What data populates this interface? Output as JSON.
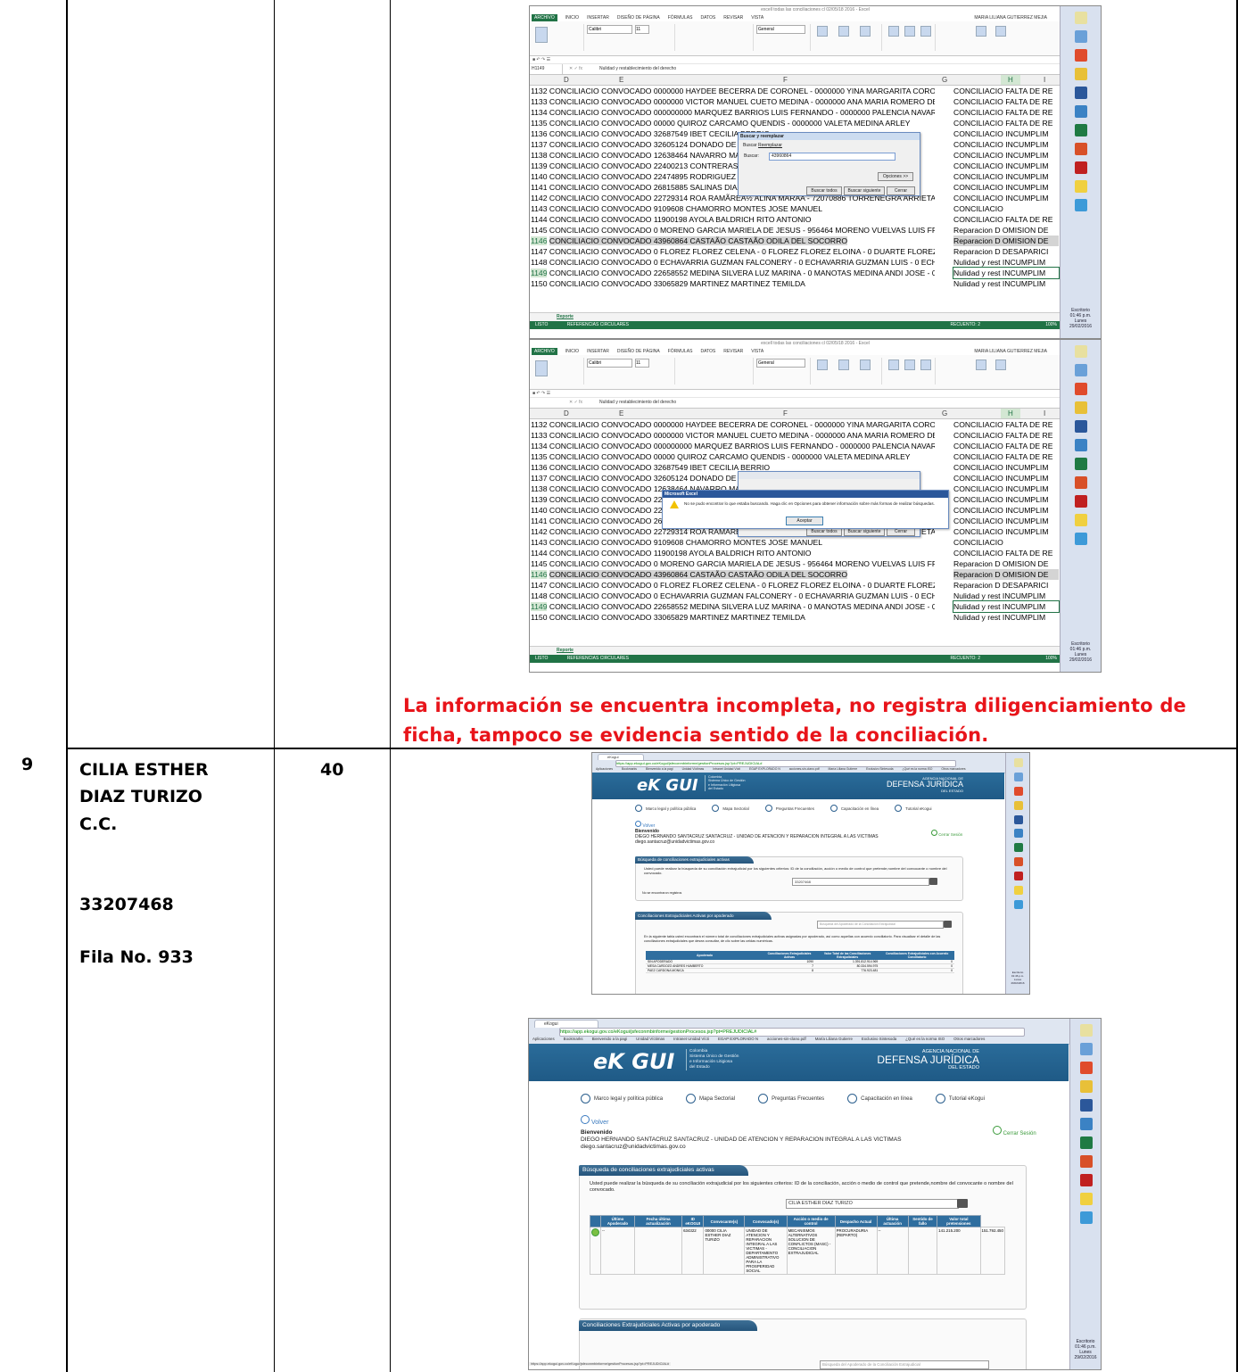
{
  "row9": {
    "number": "9",
    "name_line1": "CILIA ESTHER",
    "name_line2": "DIAZ TURIZO",
    "id_type": "C.C.",
    "id_number": "33207468",
    "row_ref": "Fila No. 933",
    "count": "40"
  },
  "note": "La información se encuentra incompleta, no registra diligenciamiento de ficha, tampoco se evidencia sentido de la conciliación.",
  "excel": {
    "title": "excell todas las conciliaciones cl 02/05/18 2016 - Excel",
    "tabs": [
      "ARCHIVO",
      "INICIO",
      "INSERTAR",
      "DISEÑO DE PÁGINA",
      "FÓRMULAS",
      "DATOS",
      "REVISAR",
      "VISTA"
    ],
    "user": "MARIA LILIANA GUTIERREZ MEJIA",
    "font_name": "Calibri",
    "font_size": "11",
    "number_format": "General",
    "cell_ref": "H1149",
    "formula": "Nulidad y restablecimiento del derecho",
    "columns": [
      "D",
      "E",
      "F",
      "G",
      "H",
      "I"
    ],
    "rows": [
      {
        "n": "1132",
        "text": "CONCILIACIO CONVOCADO 0000000  HAYDEE BECERRA DE CORONEL - 0000000  YINA MARGARITA CORONEL BECE",
        "h": "CONCILIACIO FALTA DE RE"
      },
      {
        "n": "1133",
        "text": "CONCILIACIO CONVOCADO 0000000  VICTOR MANUEL CUETO MEDINA - 0000000  ANA MARIA ROMERO DE CUET",
        "h": "CONCILIACIO FALTA DE RE"
      },
      {
        "n": "1134",
        "text": "CONCILIACIO CONVOCADO 000000000 MARQUEZ  BARRIOS LUIS FERNANDO  - 0000000 PALENCIA  NAVARRO  ONI",
        "h": "CONCILIACIO FALTA DE RE"
      },
      {
        "n": "1135",
        "text": "CONCILIACIO CONVOCADO 00000 QUIROZ  CARCAMO QUENDIS  - 0000000 VALETA  MEDINA  ARLEY",
        "h": "CONCILIACIO FALTA DE RE"
      },
      {
        "n": "1136",
        "text": "CONCILIACIO CONVOCADO 32687549 IBET CECILIA  BERRIO",
        "h": "CONCILIACIO INCUMPLIM"
      },
      {
        "n": "1137",
        "text": "CONCILIACIO CONVOCADO 32605124 DONADO  DE DONADO",
        "h": "CONCILIACIO INCUMPLIM"
      },
      {
        "n": "1138",
        "text": "CONCILIACIO CONVOCADO 12638464 NAVARRO MANOTAS",
        "h": "CONCILIACIO INCUMPLIM"
      },
      {
        "n": "1139",
        "text": "CONCILIACIO CONVOCADO 22400213 CONTRERAS ROMERO",
        "h": "CONCILIACIO INCUMPLIM"
      },
      {
        "n": "1140",
        "text": "CONCILIACIO CONVOCADO 22474895 RODRIGUEZ BALLESTAS",
        "h": "CONCILIACIO INCUMPLIM"
      },
      {
        "n": "1141",
        "text": "CONCILIACIO CONVOCADO 26815885 SALINAS DIAZ  JULIA",
        "h": "CONCILIACIO INCUMPLIM"
      },
      {
        "n": "1142",
        "text": "CONCILIACIO CONVOCADO 22729314 ROA  RAMÃREÃ½ ALINA MARÃA - 72070886  TORRENEGRA  ARRIETA FIDEL E",
        "h": "CONCILIACIO INCUMPLIM"
      },
      {
        "n": "1143",
        "text": "CONCILIACIO CONVOCADO 9109608 CHAMORRO  MONTES JOSE MANUEL",
        "h": "CONCILIACIO"
      },
      {
        "n": "1144",
        "text": "CONCILIACIO CONVOCADO 11900198 AYOLA  BALDRICH RITO ANTONIO",
        "h": "CONCILIACIO FALTA DE RE"
      },
      {
        "n": "1145",
        "text": "CONCILIACIO CONVOCADO 0 MORENO GARCIA MARIELA DE JESUS - 956464 MORENO VUELVAS LUIS FRANCISCO -",
        "h": "Reparacion D OMISION DE"
      },
      {
        "n": "1146",
        "text": "CONCILIACIO CONVOCADO 43960864 CASTAÃO CASTAÃO ODILA DEL SOCORRO",
        "h": "Reparacion D OMISION DE"
      },
      {
        "n": "1147",
        "text": "CONCILIACIO CONVOCADO 0 FLOREZ FLOREZ CELENA - 0 FLOREZ FLOREZ ELOINA - 0 DUARTE FLOREZ ROBINSON - C",
        "h": "Reparacion D DESAPARICI"
      },
      {
        "n": "1148",
        "text": "CONCILIACIO CONVOCADO 0 ECHAVARRIA GUZMAN FALCONERY - 0 ECHAVARRIA GUZMAN LUIS - 0 ECHAVARRIA G",
        "h": "Nulidad y rest INCUMPLIM"
      },
      {
        "n": "1149",
        "text": "CONCILIACIO CONVOCADO 22658552 MEDINA SILVERA LUZ MARINA - 0 MANOTAS MEDINA ANDI JOSE - 0 MANOT",
        "h": "Nulidad y rest INCUMPLIM"
      },
      {
        "n": "1150",
        "text": "CONCILIACIO CONVOCADO 33065829 MARTINEZ MARTINEZ TEMILDA",
        "h": "Nulidad y rest INCUMPLIM"
      }
    ],
    "sheet_tab": "Reporte",
    "status_left": "LISTO",
    "status_circ": "REFERENCIAS CIRCULARES",
    "status_right": "RECUENTO: 2",
    "zoom": "100%",
    "find_dialog": {
      "title": "Buscar y reemplazar",
      "tab_find": "Buscar",
      "tab_replace": "Reemplazar",
      "label": "Buscar:",
      "value": "43960864",
      "options": "Opciones >>",
      "find_all": "Buscar todos",
      "find_next": "Buscar siguiente",
      "close": "Cerrar"
    },
    "msg_dialog": {
      "title": "Microsoft Excel",
      "message": "No se pudo encontrar lo que estaba buscando. Haga clic en Opciones para obtener información sobre más formas de realizar búsquedas.",
      "ok": "Aceptar"
    }
  },
  "browser": {
    "tab_title": "eKogui",
    "url": "https://app.ekogui.gov.co/eKogui/jsfeconmbinforme/gestionProcesos.jsp?pt=PREJUDICIAL#",
    "bookmarks": [
      "Aplicaciones",
      "Bookmarks",
      "Bienvenido a la pagi",
      "Unidad Víctimas",
      "Intranet Unidad Vícti",
      "EGAP EXPLORADO N",
      "acciones-sin-clano.pdf",
      "María Liliana Gutierre",
      "Exclusivo Sintesoda",
      "¿Qué es la norma ISO",
      "Otros marcadores"
    ],
    "logo": "eK GUI",
    "logo_sub": [
      "Colombia",
      "Sistema Único de Gestión",
      "e Información Litigiosa",
      "del Estado"
    ],
    "agency_line1": "AGENCIA NACIONAL DE",
    "agency_line2": "DEFENSA JURÍDICA",
    "agency_line3": "DEL ESTADO",
    "nav": [
      "Marco legal y política pública",
      "Mapa Sectorial",
      "Preguntas Frecuentes",
      "Capacitación en línea",
      "Tutorial eKogui"
    ],
    "back": "Volver",
    "welcome": "Bienvenido",
    "logout": "Cerrar Sesión",
    "user_line": "DIEGO HERNANDO SANTACRUZ SANTACRUZ - UNIDAD DE ATENCION Y REPARACION INTEGRAL A LAS VICTIMAS",
    "user_email": "diego.santacruz@unidadvictimas.gov.co",
    "section1": "Búsqueda de conciliaciones extrajudiciales activas",
    "search_help": "Usted puede realizar la búsqueda de su conciliación extrajudicial por los siguientes criterios: ID de la conciliación, acción o medio de control que pretende,nombre del convocante o nombre del convocado.",
    "search_value_a": "33207468",
    "no_records": "No se encontraron registros",
    "section2": "Conciliaciones Extrajudiciales Activas por apoderado",
    "apoderado_placeholder": "Búsqueda del Apoderado de la Conciliación Extrajudicial",
    "apoderado_help": "En la siguiente tabla usted encontrará el número total de conciliaciones extrajudiciales activas asignadas por apoderado, así como aquellas con acuerdo conciliatorio. Para visualizar el detalle de las conciliaciones extrajudiciales que desea consultar, de clic sobre las celdas numéricas.",
    "apoderado_headers": [
      "Apoderado",
      "Conciliaciones Extrajudiciales Activas",
      "Valor Total de las Conciliaciones Extrajudiciales",
      "Conciliaciones Extrajudiciales con Acuerdo Conciliatorio"
    ],
    "apoderado_rows": [
      [
        "SIN APODERADO",
        "1090",
        "1.391.812.914.969",
        "0"
      ],
      [
        "MESA CARDOZO ANDRES HUMBERTO",
        "7",
        "80.334.594.975",
        "0"
      ],
      [
        "PAEZ CARDONA MONICA",
        "8",
        "776.923.481",
        "0"
      ]
    ],
    "search_value_b": "CILIA ESTHER DIAZ TURIZO",
    "result_headers": [
      "Último Apoderado",
      "Fecha última actualización",
      "ID eKOGUI",
      "Convocante(s)",
      "Convocado(s)",
      "Acción o medio de control",
      "Despacho Actual",
      "Última actuación",
      "Sentido de fallo",
      "Valor total pretensiones",
      "Valor pretensión indexada"
    ],
    "result_row": [
      "--",
      "",
      "634322",
      "00000 CILIA ESTHER DIAZ TURIZO",
      "UNIDAD DE ATENCION Y REPARACION INTEGRAL A LAS VICTIMAS - DEPARTAMENTO ADMINISTRATIVO PARA LA PROSPERIDAD SOCIAL",
      "MECANISMOS ALTERNATIVOS SOLUCION DE CONFLICTOS (MASC) - CONCILIACION EXTRAJUDICIAL",
      "PROCURADURIA (REPARTO)",
      "--",
      "",
      "141.215.200",
      "151.792.450"
    ],
    "status_url": "https://app.ekogui.gov.co/eKogui/jsfeconmbinforme/gestionProcesos.jsp?pt=PREJUDICIAL#"
  },
  "taskbar": {
    "lang": "Escritorio",
    "time": "01:46 p.m.",
    "day": "Lunes",
    "date": "29/02/2016"
  },
  "colors": {
    "note_red": "#e8141a",
    "excel_green": "#217346",
    "ekogui_blue": "#1f5a86"
  }
}
